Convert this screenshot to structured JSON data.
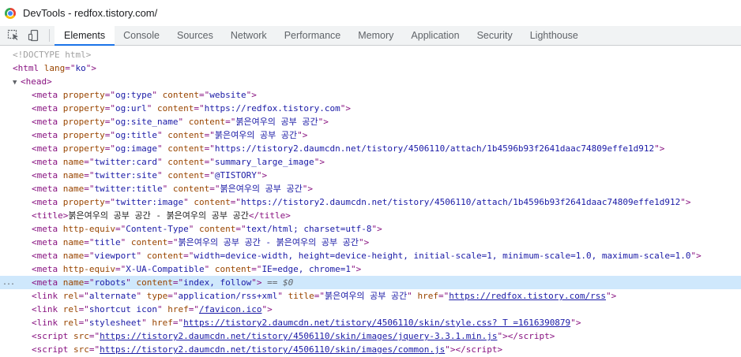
{
  "window": {
    "title": "DevTools - redfox.tistory.com/"
  },
  "toolbar": {
    "inspect_icon": "inspect-element-icon",
    "device_icon": "device-toolbar-icon",
    "tabs": [
      {
        "label": "Elements",
        "active": true
      },
      {
        "label": "Console"
      },
      {
        "label": "Sources"
      },
      {
        "label": "Network"
      },
      {
        "label": "Performance"
      },
      {
        "label": "Memory"
      },
      {
        "label": "Application"
      },
      {
        "label": "Security"
      },
      {
        "label": "Lighthouse"
      }
    ]
  },
  "dom": {
    "doctype": "<!DOCTYPE html>",
    "html_open": {
      "tag": "html",
      "attrs": [
        {
          "n": "lang",
          "v": "ko"
        }
      ]
    },
    "head_open": {
      "tag": "head"
    },
    "head_children": [
      {
        "tag": "meta",
        "attrs": [
          {
            "n": "property",
            "v": "og:type"
          },
          {
            "n": "content",
            "v": "website"
          }
        ]
      },
      {
        "tag": "meta",
        "attrs": [
          {
            "n": "property",
            "v": "og:url"
          },
          {
            "n": "content",
            "v": "https://redfox.tistory.com"
          }
        ]
      },
      {
        "tag": "meta",
        "attrs": [
          {
            "n": "property",
            "v": "og:site_name"
          },
          {
            "n": "content",
            "v": "붉은여우의 공부 공간"
          }
        ]
      },
      {
        "tag": "meta",
        "attrs": [
          {
            "n": "property",
            "v": "og:title"
          },
          {
            "n": "content",
            "v": "붉은여우의 공부 공간"
          }
        ]
      },
      {
        "tag": "meta",
        "attrs": [
          {
            "n": "property",
            "v": "og:image"
          },
          {
            "n": "content",
            "v": "https://tistory2.daumcdn.net/tistory/4506110/attach/1b4596b93f2641daac74809effe1d912"
          }
        ]
      },
      {
        "tag": "meta",
        "attrs": [
          {
            "n": "name",
            "v": "twitter:card"
          },
          {
            "n": "content",
            "v": "summary_large_image"
          }
        ]
      },
      {
        "tag": "meta",
        "attrs": [
          {
            "n": "name",
            "v": "twitter:site"
          },
          {
            "n": "content",
            "v": "@TISTORY"
          }
        ]
      },
      {
        "tag": "meta",
        "attrs": [
          {
            "n": "name",
            "v": "twitter:title"
          },
          {
            "n": "content",
            "v": "붉은여우의 공부 공간"
          }
        ]
      },
      {
        "tag": "meta",
        "attrs": [
          {
            "n": "property",
            "v": "twitter:image"
          },
          {
            "n": "content",
            "v": "https://tistory2.daumcdn.net/tistory/4506110/attach/1b4596b93f2641daac74809effe1d912"
          }
        ]
      },
      {
        "tag": "title",
        "text": "붉은여우의 공부 공간 - 붉은여우의 공부 공간",
        "close": true
      },
      {
        "tag": "meta",
        "attrs": [
          {
            "n": "http-equiv",
            "v": "Content-Type"
          },
          {
            "n": "content",
            "v": "text/html; charset=utf-8"
          }
        ]
      },
      {
        "tag": "meta",
        "attrs": [
          {
            "n": "name",
            "v": "title"
          },
          {
            "n": "content",
            "v": "붉은여우의 공부 공간 - 붉은여우의 공부 공간"
          }
        ]
      },
      {
        "tag": "meta",
        "attrs": [
          {
            "n": "name",
            "v": "viewport"
          },
          {
            "n": "content",
            "v": "width=device-width, height=device-height, initial-scale=1, minimum-scale=1.0, maximum-scale=1.0"
          }
        ]
      },
      {
        "tag": "meta",
        "attrs": [
          {
            "n": "http-equiv",
            "v": "X-UA-Compatible"
          },
          {
            "n": "content",
            "v": "IE=edge, chrome=1"
          }
        ]
      },
      {
        "tag": "meta",
        "attrs": [
          {
            "n": "name",
            "v": "robots"
          },
          {
            "n": "content",
            "v": "index, follow"
          }
        ],
        "selected": true,
        "marker": "== $0",
        "gutter": "..."
      },
      {
        "tag": "link",
        "attrs": [
          {
            "n": "rel",
            "v": "alternate"
          },
          {
            "n": "type",
            "v": "application/rss+xml"
          },
          {
            "n": "title",
            "v": "붉은여우의 공부 공간"
          },
          {
            "n": "href",
            "v": "https://redfox.tistory.com/rss",
            "link": true
          }
        ]
      },
      {
        "tag": "link",
        "attrs": [
          {
            "n": "rel",
            "v": "shortcut icon"
          },
          {
            "n": "href",
            "v": "/favicon.ico",
            "link": true
          }
        ]
      },
      {
        "tag": "link",
        "attrs": [
          {
            "n": "rel",
            "v": "stylesheet"
          },
          {
            "n": "href",
            "v": "https://tistory2.daumcdn.net/tistory/4506110/skin/style.css? T =1616390879",
            "link": true
          }
        ]
      },
      {
        "tag": "script",
        "attrs": [
          {
            "n": "src",
            "v": "https://tistory2.daumcdn.net/tistory/4506110/skin/images/jquery-3.3.1.min.js",
            "link": true
          }
        ],
        "close": true
      },
      {
        "tag": "script",
        "attrs": [
          {
            "n": "src",
            "v": "https://tistory2.daumcdn.net/tistory/4506110/skin/images/common.js",
            "link": true
          }
        ],
        "close": true
      }
    ]
  },
  "colors": {
    "tag": "#881280",
    "attr_name": "#994500",
    "attr_value": "#1a1aa6",
    "selected_row": "#cfe8fc",
    "active_tab_underline": "#1a73e8"
  }
}
